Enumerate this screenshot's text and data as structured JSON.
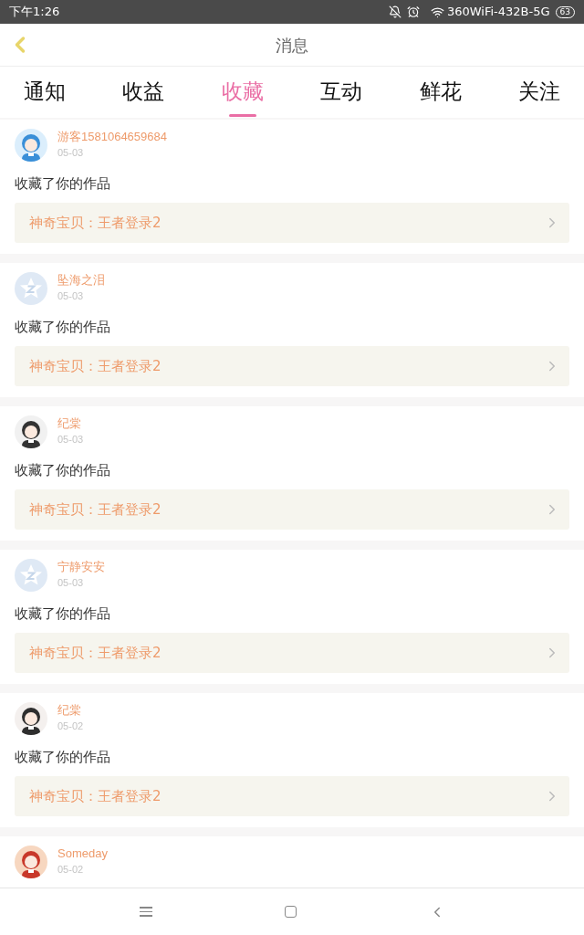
{
  "status_bar": {
    "time": "下午1:26",
    "network": "360WiFi-432B-5G",
    "battery": "63"
  },
  "header": {
    "title": "消息"
  },
  "tabs": [
    {
      "label": "通知",
      "selected": false
    },
    {
      "label": "收益",
      "selected": false
    },
    {
      "label": "收藏",
      "selected": true
    },
    {
      "label": "互动",
      "selected": false
    },
    {
      "label": "鲜花",
      "selected": false
    },
    {
      "label": "关注",
      "selected": false
    }
  ],
  "messages": [
    {
      "kind": "picture",
      "user": "游客1581064659684",
      "date": "05-03",
      "action": "收藏了你的作品",
      "work": "神奇宝贝：王者登录2"
    },
    {
      "kind": "default",
      "user": "坠海之泪",
      "date": "05-03",
      "action": "收藏了你的作品",
      "work": "神奇宝贝：王者登录2"
    },
    {
      "kind": "picture",
      "user": "纪棠",
      "date": "05-03",
      "action": "收藏了你的作品",
      "work": "神奇宝贝：王者登录2"
    },
    {
      "kind": "default",
      "user": "宁静安安",
      "date": "05-03",
      "action": "收藏了你的作品",
      "work": "神奇宝贝：王者登录2"
    },
    {
      "kind": "picture",
      "user": "纪棠",
      "date": "05-02",
      "action": "收藏了你的作品",
      "work": "神奇宝贝：王者登录2"
    },
    {
      "kind": "picture",
      "user": "Someday",
      "date": "05-02"
    }
  ]
}
